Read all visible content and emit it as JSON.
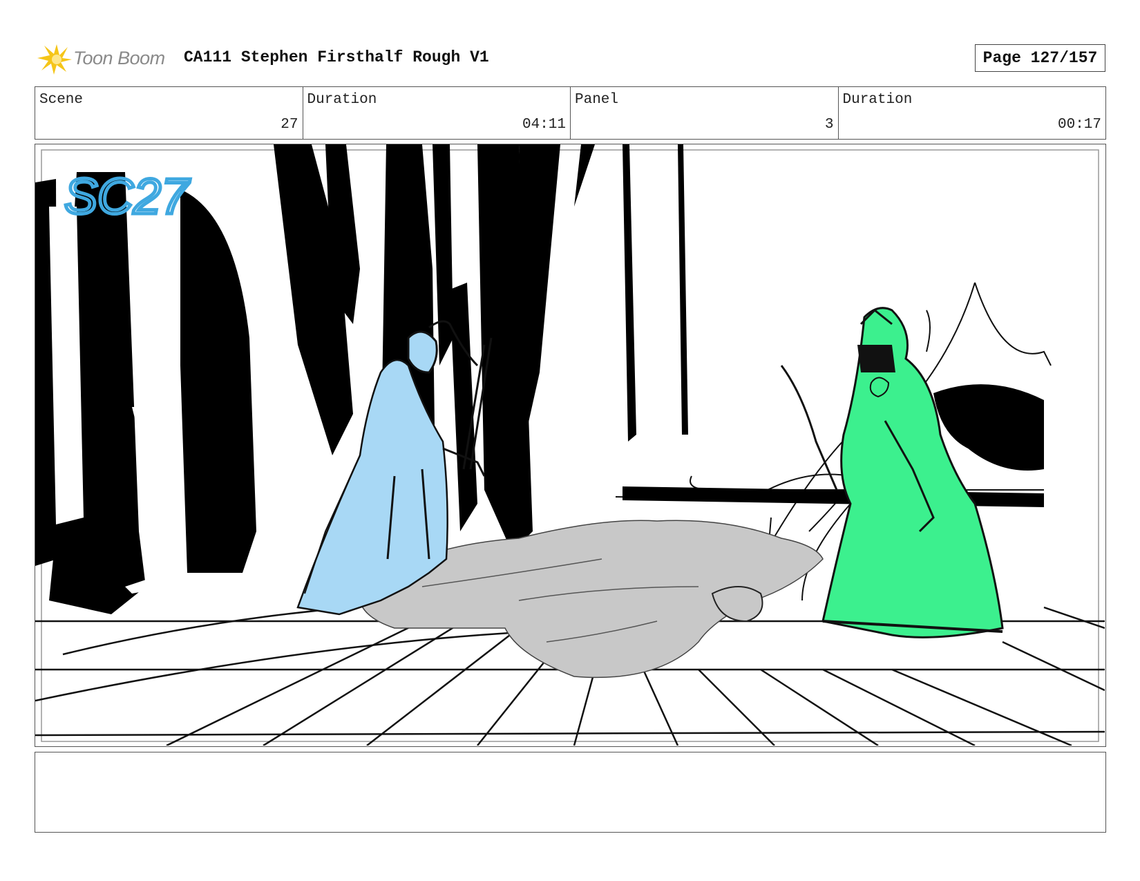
{
  "header": {
    "logo_text": "Toon Boom",
    "title": "CA111 Stephen Firsthalf Rough V1",
    "page_label": "Page 127/157"
  },
  "info": {
    "scene_label": "Scene",
    "scene_value": "27",
    "scene_duration_label": "Duration",
    "scene_duration_value": "04:11",
    "panel_label": "Panel",
    "panel_value": "3",
    "panel_duration_label": "Duration",
    "panel_duration_value": "00:17"
  },
  "panel": {
    "scene_mark": "SC27",
    "colors": {
      "knight_fill": "#a8d8f5",
      "queen_fill": "#3cf08e",
      "body_fill": "#c8c8c8",
      "scene_mark": "#3fa8e0"
    }
  },
  "notes": {
    "text": ""
  }
}
